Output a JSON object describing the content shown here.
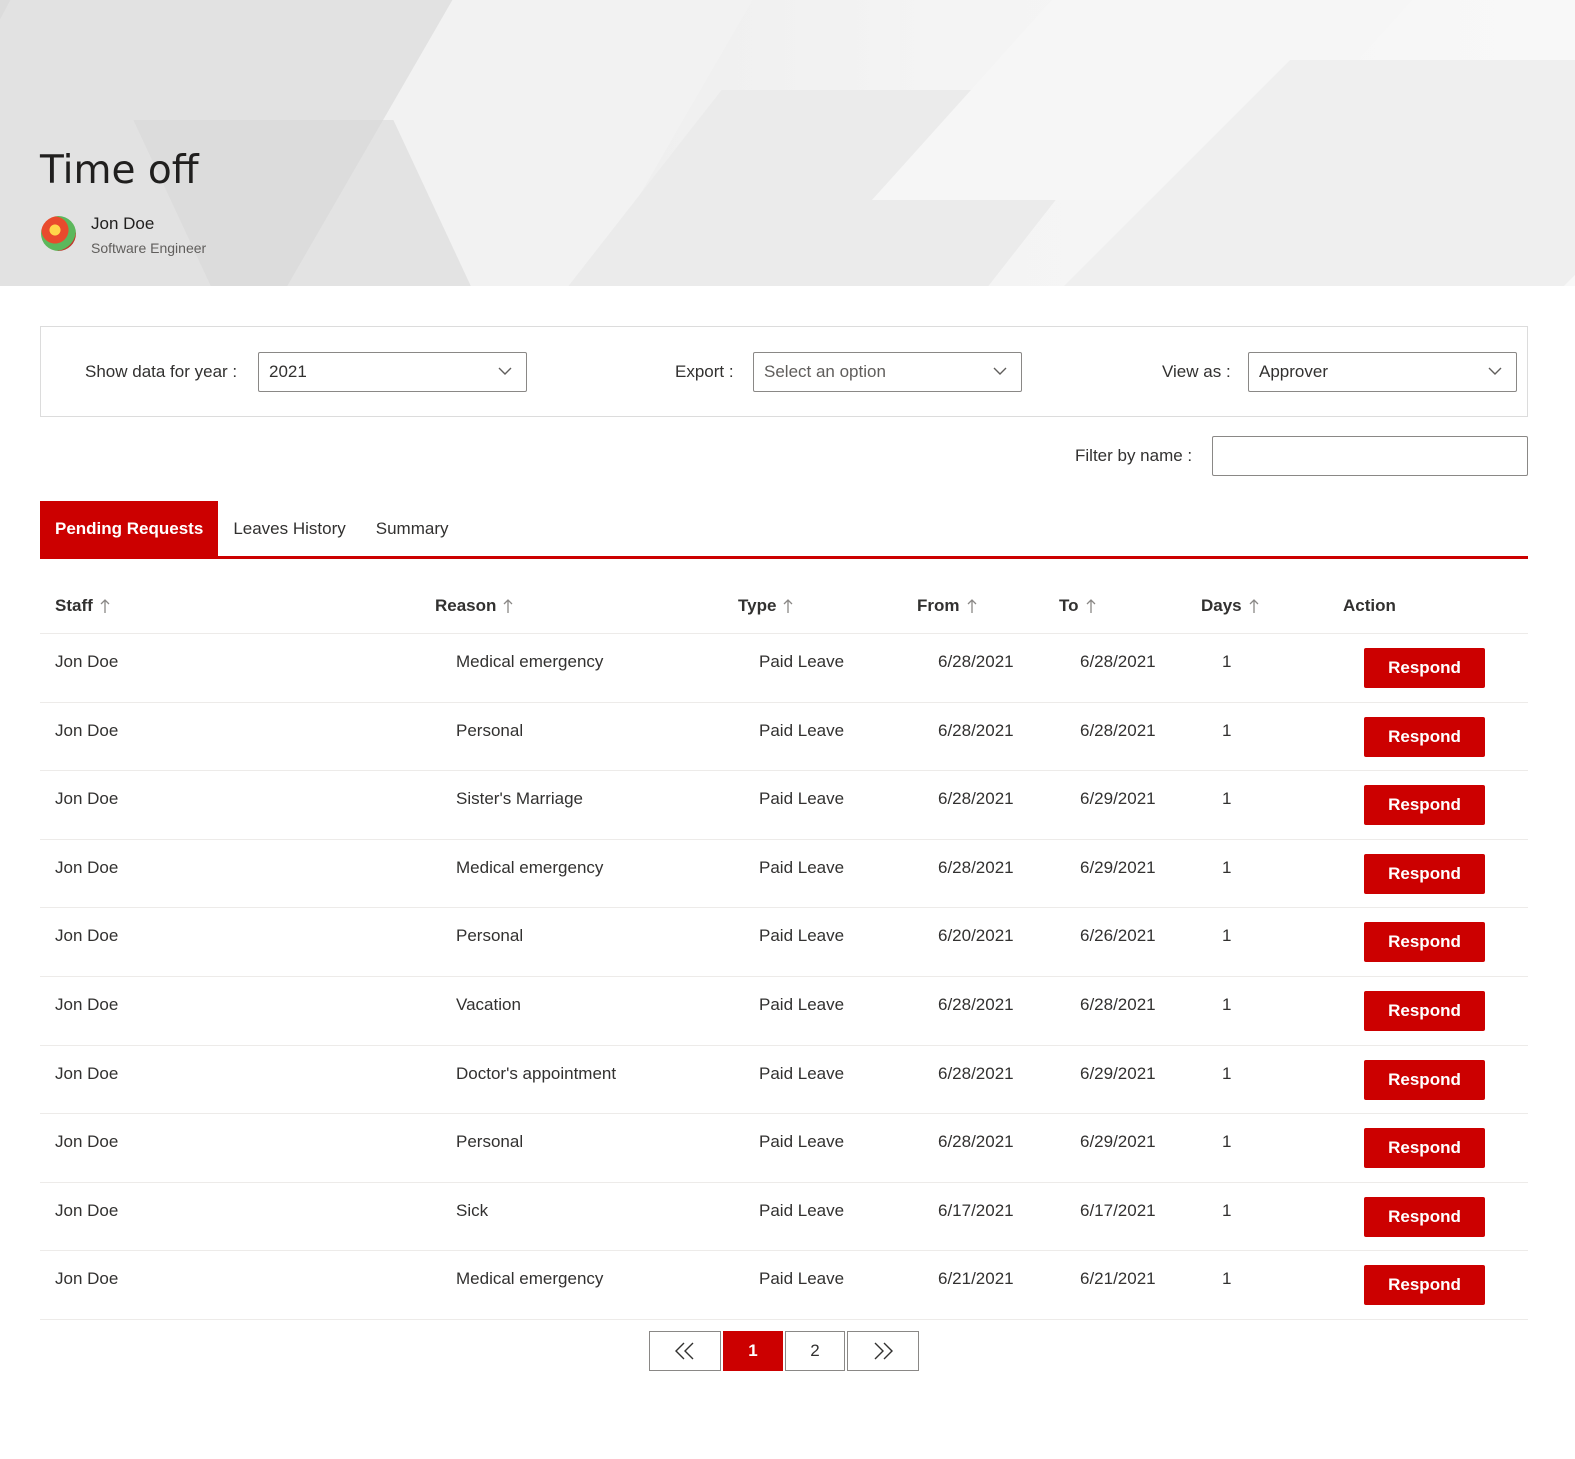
{
  "header": {
    "title": "Time off",
    "user": {
      "name": "Jon Doe",
      "role": "Software Engineer"
    }
  },
  "filters": {
    "year_label": "Show data for year :",
    "year_value": "2021",
    "export_label": "Export :",
    "export_placeholder": "Select an option",
    "view_label": "View as :",
    "view_value": "Approver",
    "name_filter_label": "Filter by name :",
    "name_filter_value": ""
  },
  "tabs": [
    {
      "label": "Pending Requests",
      "active": true
    },
    {
      "label": "Leaves History",
      "active": false
    },
    {
      "label": "Summary",
      "active": false
    }
  ],
  "table": {
    "columns": [
      "Staff",
      "Reason",
      "Type",
      "From",
      "To",
      "Days",
      "Action"
    ],
    "rows": [
      {
        "staff": "Jon Doe",
        "reason": "Medical emergency",
        "type": "Paid Leave",
        "from": "6/28/2021",
        "to": "6/28/2021",
        "days": "1",
        "action": "Respond"
      },
      {
        "staff": "Jon Doe",
        "reason": "Personal",
        "type": "Paid Leave",
        "from": "6/28/2021",
        "to": "6/28/2021",
        "days": "1",
        "action": "Respond"
      },
      {
        "staff": "Jon Doe",
        "reason": "Sister's Marriage",
        "type": "Paid Leave",
        "from": "6/28/2021",
        "to": "6/29/2021",
        "days": "1",
        "action": "Respond"
      },
      {
        "staff": "Jon Doe",
        "reason": "Medical emergency",
        "type": "Paid Leave",
        "from": "6/28/2021",
        "to": "6/29/2021",
        "days": "1",
        "action": "Respond"
      },
      {
        "staff": "Jon Doe",
        "reason": "Personal",
        "type": "Paid Leave",
        "from": "6/20/2021",
        "to": "6/26/2021",
        "days": "1",
        "action": "Respond"
      },
      {
        "staff": "Jon Doe",
        "reason": "Vacation",
        "type": "Paid Leave",
        "from": "6/28/2021",
        "to": "6/28/2021",
        "days": "1",
        "action": "Respond"
      },
      {
        "staff": "Jon Doe",
        "reason": "Doctor's appointment",
        "type": "Paid Leave",
        "from": "6/28/2021",
        "to": "6/29/2021",
        "days": "1",
        "action": "Respond"
      },
      {
        "staff": "Jon Doe",
        "reason": "Personal",
        "type": "Paid Leave",
        "from": "6/28/2021",
        "to": "6/29/2021",
        "days": "1",
        "action": "Respond"
      },
      {
        "staff": "Jon Doe",
        "reason": "Sick",
        "type": "Paid Leave",
        "from": "6/17/2021",
        "to": "6/17/2021",
        "days": "1",
        "action": "Respond"
      },
      {
        "staff": "Jon Doe",
        "reason": "Medical emergency",
        "type": "Paid Leave",
        "from": "6/21/2021",
        "to": "6/21/2021",
        "days": "1",
        "action": "Respond"
      }
    ]
  },
  "pagination": {
    "pages": [
      "1",
      "2"
    ],
    "current": "1"
  },
  "colors": {
    "accent": "#cc0000",
    "border": "#8a8886",
    "divider": "#edebe9"
  },
  "icons": {
    "dropdown": "chevron-down-icon",
    "sort": "arrow-up-icon",
    "first": "double-chevron-left-icon",
    "last": "double-chevron-right-icon"
  }
}
